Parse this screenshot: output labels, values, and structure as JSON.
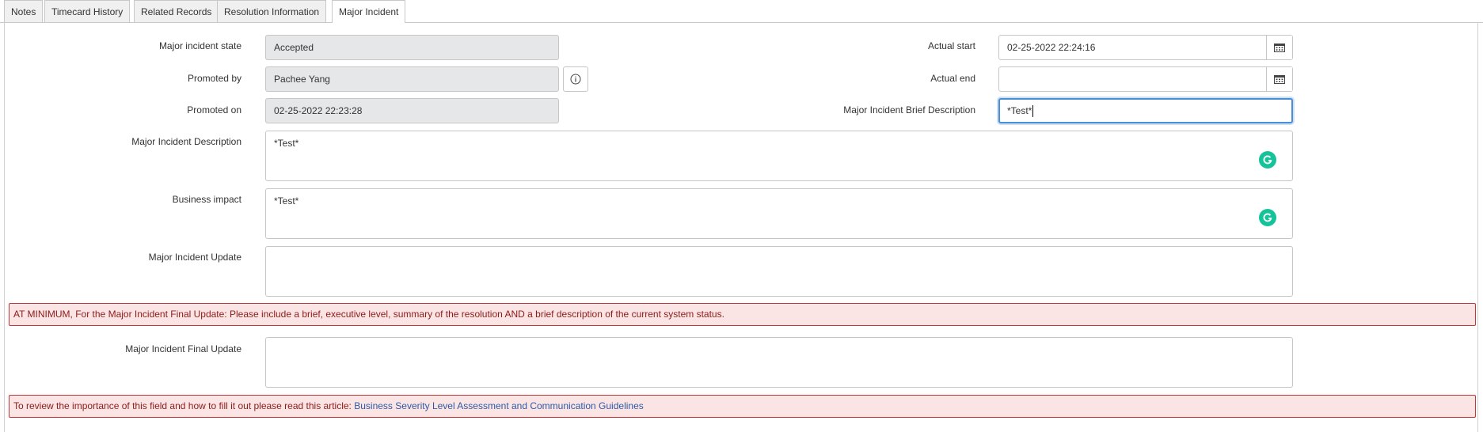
{
  "tabs": [
    {
      "label": "Notes"
    },
    {
      "label": "Timecard History"
    },
    {
      "label": "Related Records"
    },
    {
      "label": "Resolution Information"
    },
    {
      "label": "Major Incident"
    }
  ],
  "form": {
    "major_incident_state": {
      "label": "Major incident state",
      "value": "Accepted"
    },
    "promoted_by": {
      "label": "Promoted by",
      "value": "Pachee Yang"
    },
    "promoted_on": {
      "label": "Promoted on",
      "value": "02-25-2022 22:23:28"
    },
    "actual_start": {
      "label": "Actual start",
      "value": "02-25-2022 22:24:16"
    },
    "actual_end": {
      "label": "Actual end",
      "value": ""
    },
    "brief_description": {
      "label": "Major Incident Brief Description",
      "value": "*Test*"
    },
    "description": {
      "label": "Major Incident Description",
      "value": "*Test*"
    },
    "business_impact": {
      "label": "Business impact",
      "value": "*Test*"
    },
    "update": {
      "label": "Major Incident Update",
      "value": ""
    },
    "final_update": {
      "label": "Major Incident Final Update",
      "value": ""
    }
  },
  "alerts": {
    "final_update_notice": "AT MINIMUM, For the Major Incident Final Update: Please include a brief, executive level, summary of the resolution AND a brief description of the current system status.",
    "review_notice": "To review the importance of this field and how to fill it out please read this article:",
    "review_link": "Business Severity Level Assessment and Communication Guidelines"
  },
  "icons": {
    "info": "info-icon",
    "calendar": "calendar-icon",
    "grammarly": "grammarly-icon"
  },
  "colors": {
    "alert_border": "#c0393a",
    "alert_bg": "#fbe4e4",
    "focus_border": "#4a8fd6",
    "grammarly": "#15c39a",
    "link": "#2d5aa6"
  }
}
